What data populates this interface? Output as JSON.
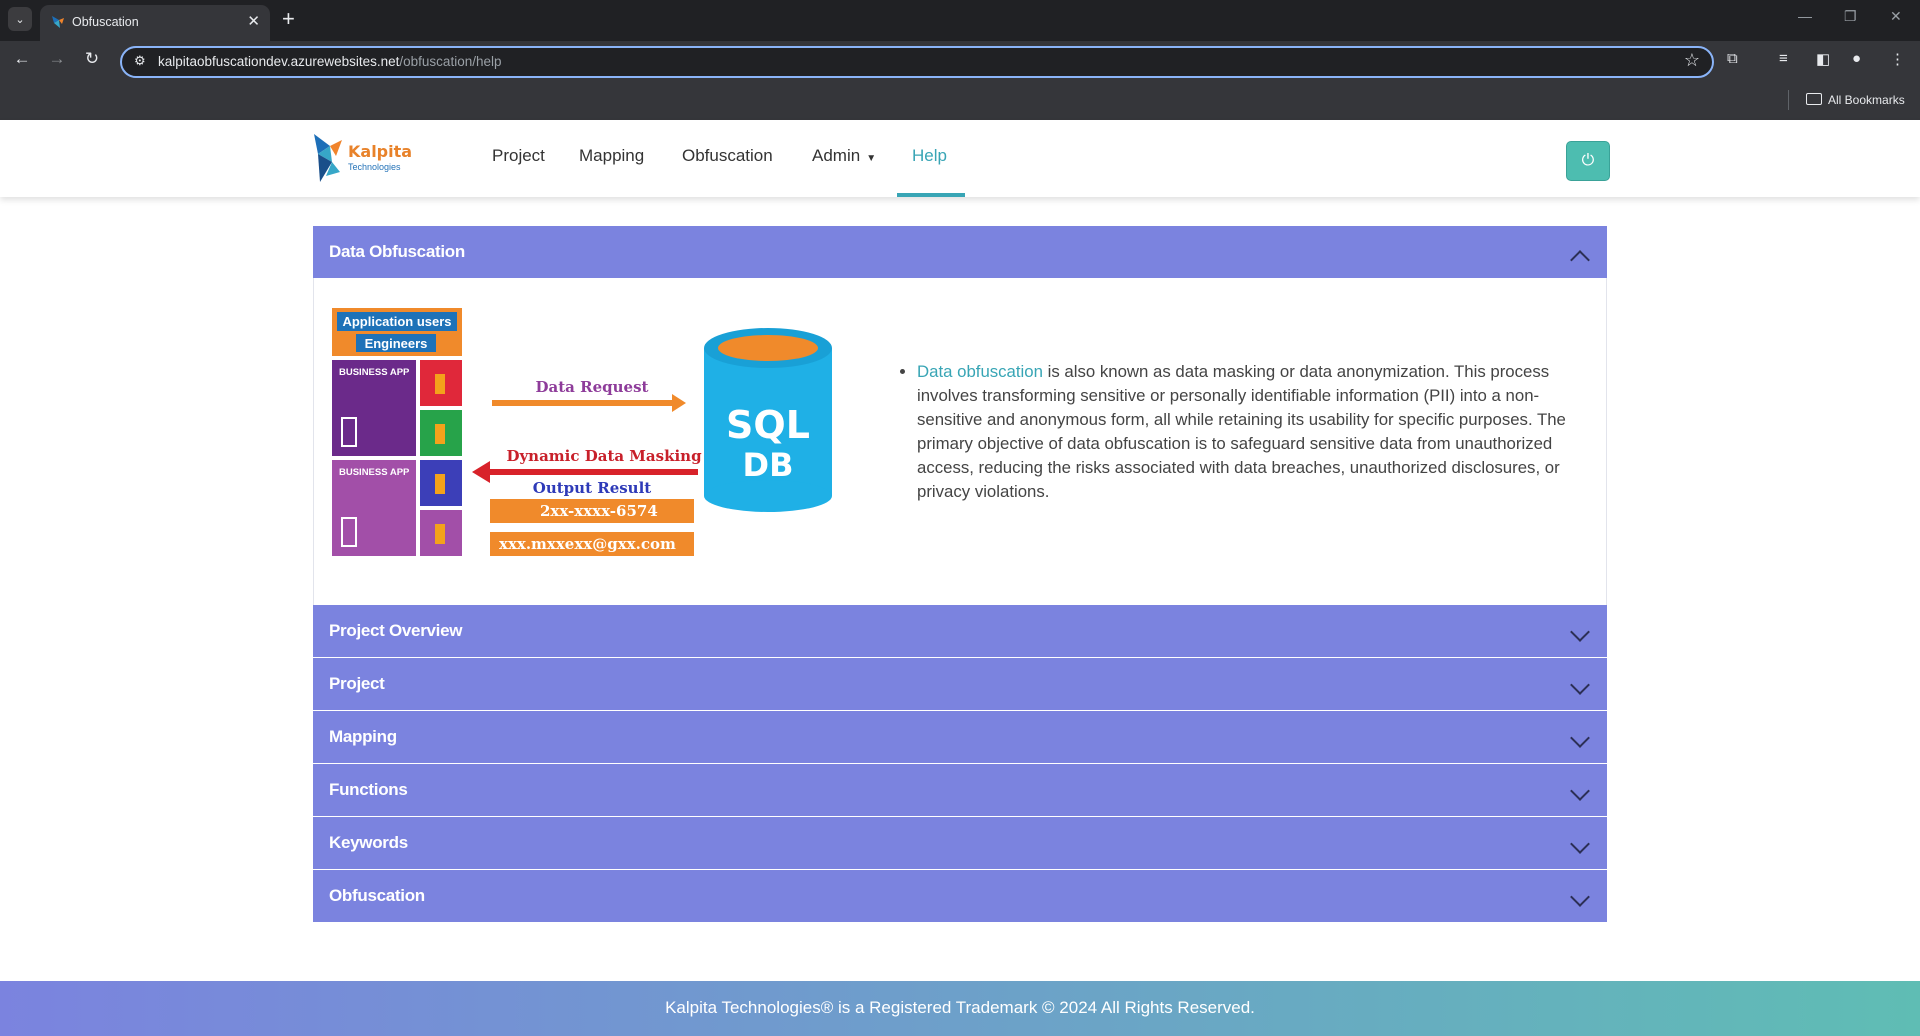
{
  "browser": {
    "tab_title": "Obfuscation",
    "url_host": "kalpitaobfuscationdev.azurewebsites.net",
    "url_path": "/obfuscation/help",
    "bookmarks_label": "All Bookmarks"
  },
  "nav": {
    "brand_name": "Kalpita",
    "brand_sub": "Technologies",
    "items": [
      {
        "label": "Project"
      },
      {
        "label": "Mapping"
      },
      {
        "label": "Obfuscation"
      },
      {
        "label": "Admin"
      },
      {
        "label": "Help",
        "active": true
      }
    ]
  },
  "diagram": {
    "users_title": "Application users",
    "users_sub": "Engineers",
    "business_app": "BUSINESS APP",
    "data_request": "Data Request",
    "masking": "Dynamic Data Masking",
    "output": "Output Result",
    "masked_phone": "2xx-xxxx-6574",
    "masked_email": "xxx.mxxexx@gxx.com",
    "db_line1": "SQL",
    "db_line2": "DB"
  },
  "sections": {
    "open": {
      "title": "Data Obfuscation"
    },
    "collapsed": [
      {
        "title": "Project Overview"
      },
      {
        "title": "Project"
      },
      {
        "title": "Mapping"
      },
      {
        "title": "Functions"
      },
      {
        "title": "Keywords"
      },
      {
        "title": "Obfuscation"
      }
    ]
  },
  "description": {
    "link_text": "Data obfuscation",
    "body": " is also known as data masking or data anonymization. This process involves transforming sensitive or personally identifiable information (PII) into a non-sensitive and anonymous form, all while retaining its usability for specific purposes. The primary objective of data obfuscation is to safeguard sensitive data from unauthorized access, reducing the risks associated with data breaches, unauthorized disclosures, or privacy violations."
  },
  "footer": {
    "text": "Kalpita Technologies® is a Registered Trademark © 2024 All Rights Reserved."
  },
  "colors": {
    "accent": "#38a5b5",
    "accordion_header": "#7b83df",
    "power_button": "#4dbdb0"
  }
}
